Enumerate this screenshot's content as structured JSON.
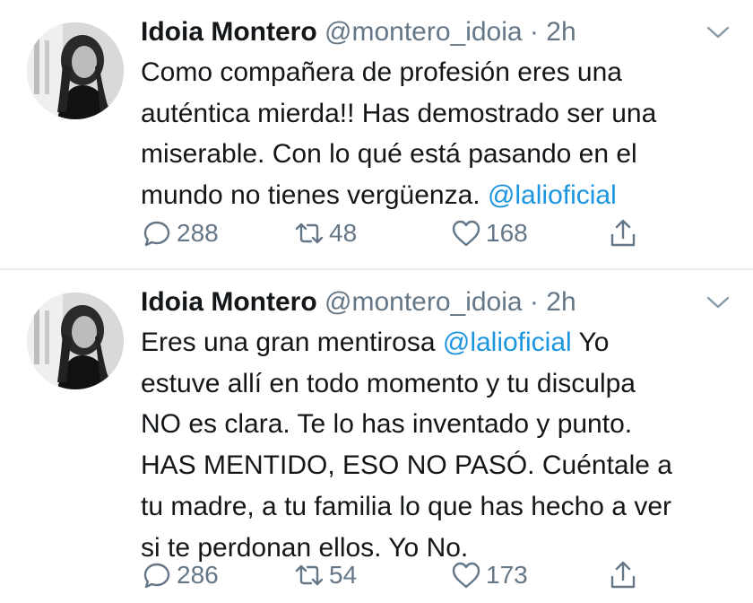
{
  "tweets": [
    {
      "name": "Idoia Montero",
      "handle": "@montero_idoia",
      "dot": "·",
      "time": "2h",
      "lines": [
        "Como compañera de profesión eres una",
        "auténtica mierda!! Has demostrado ser una",
        "miserable. Con lo qué está pasando en el"
      ],
      "last_line_text": "mundo no tienes vergüenza.",
      "mention": "@lalioficial",
      "replies": "288",
      "retweets": "48",
      "likes": "168"
    },
    {
      "name": "Idoia Montero",
      "handle": "@montero_idoia",
      "dot": "·",
      "time": "2h",
      "first_line_text": "Eres una gran mentirosa",
      "mention": "@lalioficial",
      "first_line_after": "Yo",
      "lines": [
        "estuve allí en todo momento y tu disculpa",
        "NO es clara. Te lo has inventado y punto.",
        "HAS MENTIDO, ESO NO PASÓ. Cuéntale  a",
        "tu madre, a tu familia lo que has hecho a ver",
        "si te perdonan ellos. Yo No."
      ],
      "replies": "286",
      "retweets": "54",
      "likes": "173"
    }
  ],
  "icons": {
    "reply": "reply-icon",
    "retweet": "retweet-icon",
    "like": "heart-icon",
    "share": "share-icon",
    "menu": "chevron-down-icon"
  },
  "colors": {
    "text": "#14171a",
    "secondary": "#657786",
    "link": "#1b95e0",
    "divider": "#e6ecf0"
  }
}
